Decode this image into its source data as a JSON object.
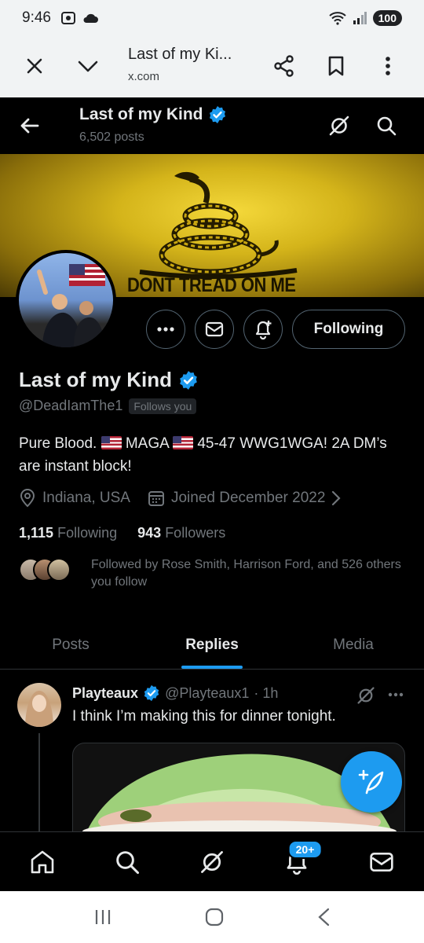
{
  "status": {
    "time": "9:46",
    "battery": "100"
  },
  "chrome": {
    "title": "Last of my Ki...",
    "url": "x.com"
  },
  "topnav": {
    "name": "Last of my Kind",
    "posts": "6,502 posts"
  },
  "banner": {
    "text": "DONT TREAD ON ME"
  },
  "actions": {
    "following_label": "Following"
  },
  "profile": {
    "name": "Last of my Kind",
    "handle": "@DeadIamThe1",
    "follows_you": "Follows you",
    "bio_part1": "Pure Blood. ",
    "bio_part2": " MAGA ",
    "bio_part3": " 45-47 WWG1WGA! 2A DM’s are instant block!",
    "location": "Indiana, USA",
    "joined": "Joined December 2022",
    "following_count": "1,115",
    "following_label": "Following",
    "followers_count": "943",
    "followers_label": "Followers",
    "followed_by": "Followed by Rose Smith, Harrison Ford, and 526 others you follow"
  },
  "tabs": [
    {
      "label": "Posts"
    },
    {
      "label": "Replies"
    },
    {
      "label": "Media"
    }
  ],
  "tweet": {
    "name": "Playteaux",
    "handle": "@Playteaux1",
    "time": "· 1h",
    "text": "I think I’m making this for dinner tonight."
  },
  "bottomnav": {
    "notifications_badge": "20+"
  },
  "colors": {
    "accent": "#1d9bf0",
    "background": "#000000",
    "muted": "#71767b"
  }
}
